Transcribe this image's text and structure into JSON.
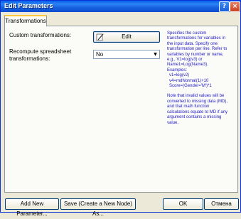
{
  "window": {
    "title": "Edit Parameters",
    "help_button": "?",
    "close_button": "×"
  },
  "tabs": [
    {
      "label": "Transformations",
      "selected": true
    }
  ],
  "form": {
    "custom_label": "Custom transformations:",
    "edit_label": "Edit",
    "recompute_label_line1": "Recompute spreadsheet",
    "recompute_label_line2": "transformations:",
    "recompute_value": "No"
  },
  "help_text": {
    "lines": [
      "Specifies the custom",
      "transformations for variables in",
      "the input data. Specify one",
      "transformation per line. Refer to",
      "variables by number or name,",
      "e.g., V1=log(v3) or",
      "Name1=Log(Name3).",
      "Examples:",
      "v1=log(v2)",
      "v4=rndNormal(1)+10",
      "Score=(Gender='M')*1"
    ],
    "note_lines": [
      "Note that invalid values will be",
      "converted to missing data (MD),",
      "and that math function",
      "calculations equate to MD if any",
      "argument contains a missing",
      "value."
    ]
  },
  "buttons": {
    "add_param": "Add New Parameter...",
    "save_node": "Save (Create a New Node) As...",
    "ok": "OK",
    "cancel": "Отмена"
  },
  "colors": {
    "help_text": "#1f1ac8",
    "titlebar": "#0a5fe8"
  }
}
